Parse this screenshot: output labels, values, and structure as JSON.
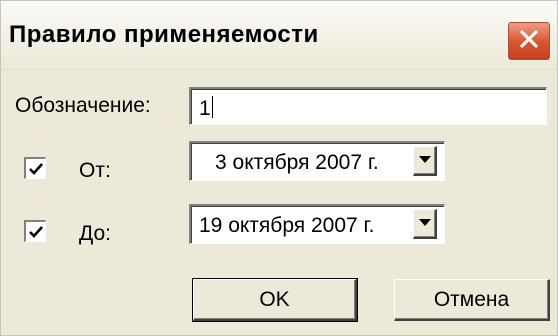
{
  "window": {
    "title": "Правило применяемости",
    "close_icon": "close-icon"
  },
  "form": {
    "designation_label": "Обозначение:",
    "designation_value": "1",
    "from_checked": true,
    "from_label": "От:",
    "from_date": "3  октября  2007 г.",
    "to_checked": true,
    "to_label": "До:",
    "to_date": "19  октября  2007 г."
  },
  "buttons": {
    "ok_label": "OK",
    "cancel_label": "Отмена"
  },
  "colors": {
    "dialog_bg": "#ece9d8",
    "close_button": "#d9532c"
  }
}
